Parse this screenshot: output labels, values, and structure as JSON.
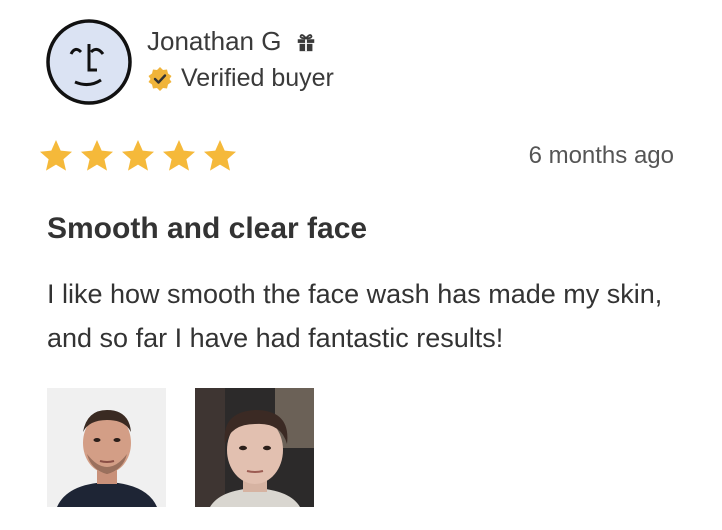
{
  "reviewer": {
    "name": "Jonathan G",
    "verified_label": "Verified buyer",
    "avatar_icon": "face-doodle-icon",
    "gift_icon": "gift-icon",
    "badge_icon": "verified-badge-icon"
  },
  "review": {
    "rating": 5,
    "max_rating": 5,
    "date": "6 months ago",
    "title": "Smooth and clear face",
    "body": "I like how smooth the face wash has made my skin, and so far I have had fantastic results!"
  },
  "photos": [
    {
      "name": "review-photo-1"
    },
    {
      "name": "review-photo-2"
    }
  ],
  "colors": {
    "star": "#f5b93a",
    "badge": "#f0b43a",
    "avatar_bg": "#dbe3f3",
    "text": "#333333"
  }
}
